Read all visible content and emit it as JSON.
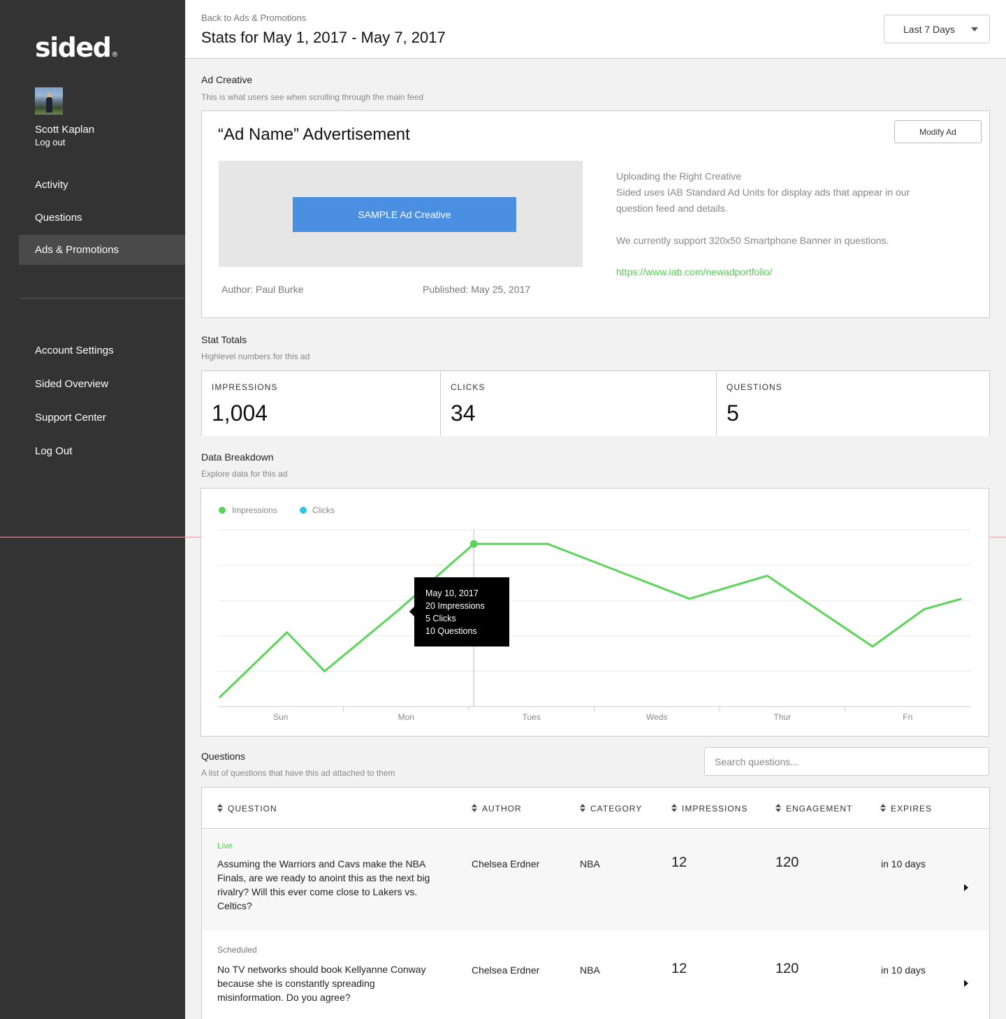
{
  "brand": {
    "logo": "sided",
    "reg": "®"
  },
  "user": {
    "name": "Scott Kaplan",
    "logout": "Log out"
  },
  "nav": {
    "items": [
      {
        "label": "Activity"
      },
      {
        "label": "Questions"
      },
      {
        "label": "Ads & Promotions",
        "active": true
      }
    ],
    "secondary": [
      {
        "label": "Account Settings"
      },
      {
        "label": "Sided Overview"
      },
      {
        "label": "Support Center"
      },
      {
        "label": "Log Out"
      }
    ]
  },
  "header": {
    "back": "Back to Ads & Promotions",
    "title": "Stats for May 1, 2017 - May 7, 2017",
    "range": "Last 7 Days"
  },
  "ad_creative": {
    "section_title": "Ad Creative",
    "section_sub": "This is what users see when scrolling through the main feed",
    "title": "“Ad Name” Advertisement",
    "modify": "Modify Ad",
    "sample": "SAMPLE Ad Creative",
    "author": "Author: Paul Burke",
    "published": "Published: May 25, 2017",
    "info_heading": "Uploading the Right Creative",
    "info_line1": "Sided uses IAB Standard Ad Units for display ads that appear in our",
    "info_line2": "question feed and details.",
    "info_line3": "We currently support 320x50 Smartphone Banner in questions.",
    "link": "https://www.iab.com/newadportfolio/"
  },
  "stat_totals": {
    "section_title": "Stat Totals",
    "section_sub": "Highlevel numbers for this ad",
    "items": [
      {
        "label": "IMPRESSIONS",
        "value": "1,004"
      },
      {
        "label": "CLICKS",
        "value": "34"
      },
      {
        "label": "QUESTIONS",
        "value": "5"
      }
    ]
  },
  "breakdown": {
    "section_title": "Data Breakdown",
    "section_sub": "Explore data for this ad",
    "legend": [
      {
        "name": "Impressions",
        "color": "#5ad55a"
      },
      {
        "name": "Clicks",
        "color": "#2ec4e6"
      }
    ],
    "tooltip": {
      "date": "May 10, 2017",
      "impressions": "20 Impressions",
      "clicks": "5 Clicks",
      "questions": "10 Questions"
    }
  },
  "chart_data": {
    "type": "line",
    "categories": [
      "Sun",
      "Mon",
      "Tues",
      "Weds",
      "Thur",
      "Fri"
    ],
    "ylim": [
      0,
      1
    ],
    "grid": true,
    "legend_placement": "top-left",
    "series": [
      {
        "name": "Impressions",
        "color": "#5ad55a",
        "x": [
          -0.49,
          0.05,
          0.35,
          0.93,
          1.54,
          2.13,
          3.26,
          3.88,
          4.72,
          5.13,
          5.43
        ],
        "values": [
          0.05,
          0.42,
          0.2,
          0.54,
          0.92,
          0.92,
          0.61,
          0.74,
          0.34,
          0.55,
          0.61
        ]
      },
      {
        "name": "Clicks",
        "color": "#2ec4e6",
        "x": [],
        "values": []
      }
    ]
  },
  "questions": {
    "section_title": "Questions",
    "section_sub": "A list of questions that have this ad attached to them",
    "search_placeholder": "Search questions...",
    "columns": [
      "QUESTION",
      "AUTHOR",
      "CATEGORY",
      "IMPRESSIONS",
      "ENGAGEMENT",
      "EXPIRES"
    ],
    "rows": [
      {
        "status": "Live",
        "status_color": "#4cd24c",
        "question": "Assuming the Warriors and Cavs make the NBA Finals, are we ready to anoint this as the next big rivalry? Will this ever come close to Lakers vs. Celtics?",
        "author": "Chelsea Erdner",
        "category": "NBA",
        "impressions": "12",
        "engagement": "120",
        "expires": "in 10 days"
      },
      {
        "status": "Scheduled",
        "status_color": "#777777",
        "question": "No TV networks should book Kellyanne Conway because she is constantly spreading misinformation. Do you agree?",
        "author": "Chelsea Erdner",
        "category": "NBA",
        "impressions": "12",
        "engagement": "120",
        "expires": "in 10 days"
      }
    ]
  }
}
